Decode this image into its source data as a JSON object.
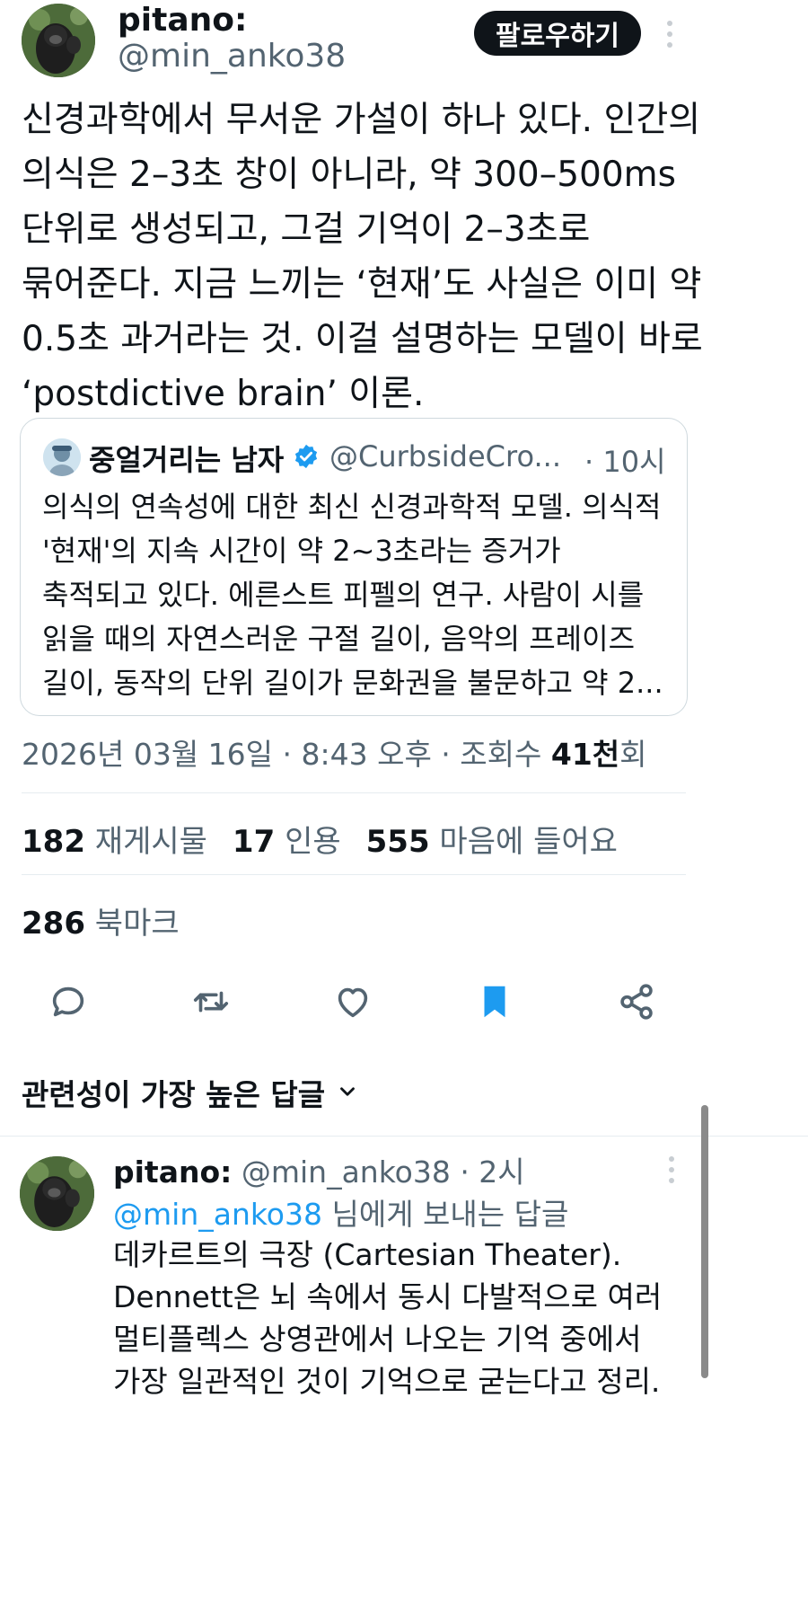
{
  "colors": {
    "text_primary": "#0f1419",
    "text_secondary": "#536471",
    "link": "#1d9bf0",
    "verified": "#1d9bf0",
    "bookmark_active": "#1d9bf0",
    "follow_button_bg": "#0f1419"
  },
  "post": {
    "author_name": "pitano:",
    "author_handle": "@min_anko38",
    "follow_label": "팔로우하기",
    "text": "신경과학에서 무서운 가설이 하나 있다. 인간의\n의식은 2–3초 창이 아니라, 약 300–500ms\n단위로 생성되고, 그걸 기억이 2–3초로\n묶어준다. 지금 느끼는 ‘현재’도 사실은 이미 약\n0.5초 과거라는 것. 이걸 설명하는 모델이 바로\n‘postdictive brain’ 이론.",
    "quote": {
      "author_name": "중얼거리는 남자",
      "author_handle": "@CurbsideCro...",
      "time": "· 10시",
      "text": "의식의 연속성에 대한 최신 신경과학적 모델. 의식적\n'현재'의 지속 시간이 약 2~3초라는 증거가\n축적되고 있다. 에른스트 피펠의 연구. 사람이 시를\n읽을 때의 자연스러운 구절 길이, 음악의 프레이즈\n길이, 동작의 단위 길이가 문화권을 불문하고 약 2..."
    },
    "meta": {
      "timestamp": "2026년 03월 16일 · 8:43 오후 · 조회수 ",
      "views_number": "41천",
      "views_suffix": "회"
    },
    "stats": {
      "reposts_count": "182",
      "reposts_label": "재게시물",
      "quotes_count": "17",
      "quotes_label": "인용",
      "likes_count": "555",
      "likes_label": "마음에 들어요",
      "bookmarks_count": "286",
      "bookmarks_label": "북마크"
    },
    "actions": [
      "reply-icon",
      "repost-icon",
      "like-icon",
      "bookmark-icon",
      "share-icon"
    ]
  },
  "replies_sort": {
    "label": "관련성이 가장 높은 답글"
  },
  "reply": {
    "author_name": "pitano:",
    "author_handle": "@min_anko38",
    "time": "· 2시",
    "replying_to_handle": "@min_anko38",
    "replying_to_suffix": " 님에게 보내는 답글",
    "text": "데카르트의 극장 (Cartesian Theater).\nDennett은 뇌 속에서 동시 다발적으로 여러\n멀티플렉스 상영관에서 나오는 기억 중에서\n가장 일관적인 것이 기억으로 굳는다고 정리."
  }
}
